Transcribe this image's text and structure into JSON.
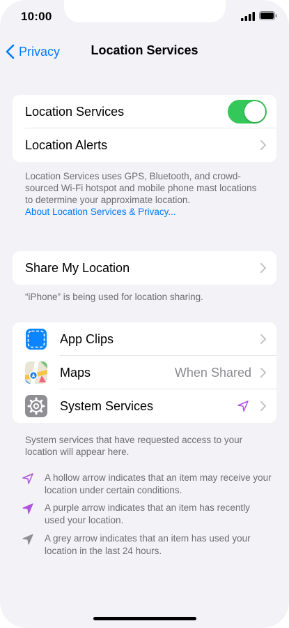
{
  "status": {
    "time": "10:00"
  },
  "nav": {
    "back_label": "Privacy",
    "title": "Location Services"
  },
  "group1": {
    "location_services": {
      "label": "Location Services",
      "enabled": true
    },
    "location_alerts": {
      "label": "Location Alerts"
    }
  },
  "footer1": {
    "text": "Location Services uses GPS, Bluetooth, and crowd-sourced Wi-Fi hotspot and mobile phone mast locations to determine your approximate location.",
    "link": "About Location Services & Privacy..."
  },
  "group2": {
    "share_my_location": {
      "label": "Share My Location"
    }
  },
  "footer2": {
    "text": "“iPhone” is being used for location sharing."
  },
  "apps": [
    {
      "label": "App Clips",
      "detail": "",
      "icon": "app-clips-icon"
    },
    {
      "label": "Maps",
      "detail": "When Shared",
      "icon": "maps-icon"
    },
    {
      "label": "System Services",
      "detail": "",
      "icon": "gear-icon",
      "status_icon": "hollow-purple-arrow-icon"
    }
  ],
  "footer3": {
    "text": "System services that have requested access to your location will appear here."
  },
  "legend": [
    {
      "icon": "hollow-arrow-icon",
      "text": "A hollow arrow indicates that an item may receive your location under certain conditions."
    },
    {
      "icon": "purple-arrow-icon",
      "text": "A purple arrow indicates that an item has recently used your location."
    },
    {
      "icon": "grey-arrow-icon",
      "text": "A grey arrow indicates that an item has used your location in the last 24 hours."
    }
  ],
  "colors": {
    "accent": "#007aff",
    "toggle_on": "#34c759",
    "purple": "#af52de",
    "grey": "#8e8e93"
  }
}
